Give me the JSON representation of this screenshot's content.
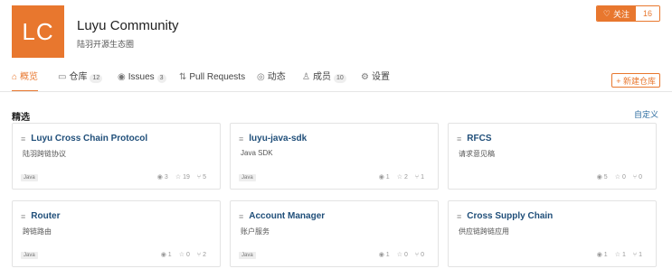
{
  "org": {
    "avatar_initials": "LC",
    "avatar_color": "#e8772e",
    "name": "Luyu Community",
    "description": "陆羽开源生态圈"
  },
  "follow": {
    "icon": "heart-icon",
    "label": "关注",
    "count": "16"
  },
  "tabs": [
    {
      "icon": "home-icon",
      "label": "概览",
      "badge": "",
      "active": true
    },
    {
      "icon": "repo-icon",
      "label": "仓库",
      "badge": "12",
      "active": false
    },
    {
      "icon": "issue-icon",
      "label": "Issues",
      "badge": "3",
      "active": false
    },
    {
      "icon": "pull-request-icon",
      "label": "Pull Requests",
      "badge": "",
      "active": false
    },
    {
      "icon": "activity-icon",
      "label": "动态",
      "badge": "",
      "active": false
    },
    {
      "icon": "members-icon",
      "label": "成员",
      "badge": "10",
      "active": false
    },
    {
      "icon": "gear-icon",
      "label": "设置",
      "badge": "",
      "active": false
    }
  ],
  "new_repo_label": "+ 新建仓库",
  "featured": {
    "title": "精选",
    "customize_label": "自定义"
  },
  "repos": [
    {
      "name": "Luyu Cross Chain Protocol",
      "description": "陆羽跨链协议",
      "language": "Java",
      "watchers": "3",
      "stars": "19",
      "forks": "5"
    },
    {
      "name": "luyu-java-sdk",
      "description": "Java SDK",
      "language": "Java",
      "watchers": "1",
      "stars": "2",
      "forks": "1"
    },
    {
      "name": "RFCS",
      "description": "请求意见稿",
      "language": "",
      "watchers": "5",
      "stars": "0",
      "forks": "0"
    },
    {
      "name": "Router",
      "description": "跨链路由",
      "language": "Java",
      "watchers": "1",
      "stars": "0",
      "forks": "2"
    },
    {
      "name": "Account Manager",
      "description": "账户服务",
      "language": "Java",
      "watchers": "1",
      "stars": "0",
      "forks": "0"
    },
    {
      "name": "Cross Supply Chain",
      "description": "供应链跨链应用",
      "language": "",
      "watchers": "1",
      "stars": "1",
      "forks": "1"
    }
  ]
}
